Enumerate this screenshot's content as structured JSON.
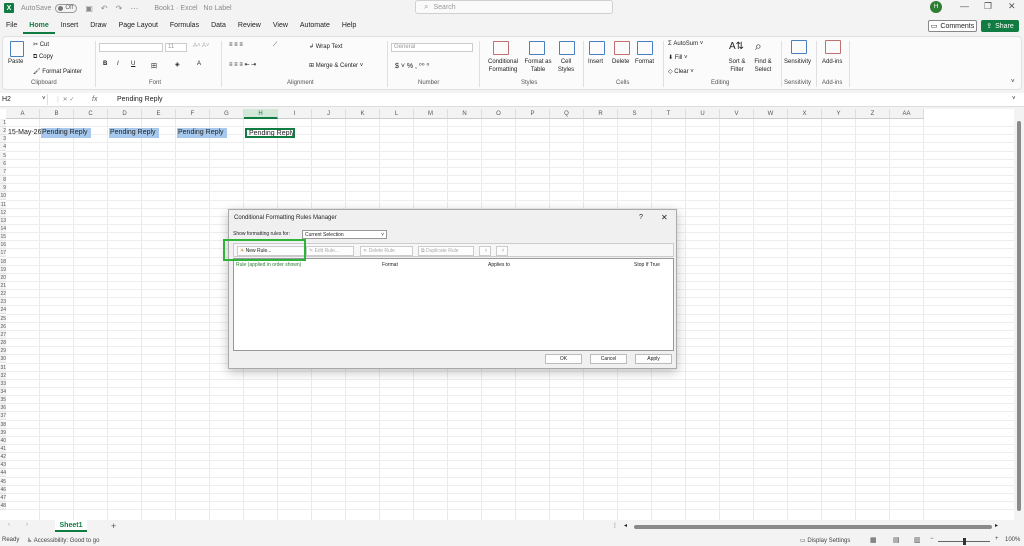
{
  "titlebar": {
    "autosave_label": "AutoSave",
    "autosave_state": "Off",
    "doc_title": "Book1  ·  Excel",
    "label_text": "No Label",
    "search_placeholder": "Search",
    "avatar_initial": "H"
  },
  "menu": {
    "items": [
      "File",
      "Home",
      "Insert",
      "Draw",
      "Page Layout",
      "Formulas",
      "Data",
      "Review",
      "View",
      "Automate",
      "Help"
    ],
    "active": "Home",
    "comments": "Comments",
    "share": "Share"
  },
  "ribbon": {
    "clipboard": {
      "paste": "Paste",
      "cut": "Cut",
      "copy": "Copy",
      "format_painter": "Format Painter",
      "label": "Clipboard"
    },
    "font": {
      "label": "Font",
      "size": "11"
    },
    "alignment": {
      "wrap": "Wrap Text",
      "merge": "Merge & Center",
      "label": "Alignment"
    },
    "number": {
      "format": "General",
      "label": "Number"
    },
    "styles": {
      "cond": "Conditional Formatting",
      "table": "Format as Table",
      "cell": "Cell Styles",
      "label": "Styles"
    },
    "cells": {
      "insert": "Insert",
      "delete": "Delete",
      "format": "Format",
      "label": "Cells"
    },
    "editing": {
      "autosum": "AutoSum",
      "fill": "Fill",
      "clear": "Clear",
      "sort": "Sort & Filter",
      "find": "Find & Select",
      "label": "Editing"
    },
    "sensitivity": {
      "btn": "Sensitivity",
      "label": "Sensitivity"
    },
    "addins": {
      "btn": "Add-ins",
      "label": "Add-ins"
    }
  },
  "formula_bar": {
    "name_box": "H2",
    "fx": "fx",
    "value": "Pending Reply"
  },
  "grid": {
    "columns": [
      "A",
      "B",
      "C",
      "D",
      "E",
      "F",
      "G",
      "H",
      "I",
      "J",
      "K",
      "L",
      "M",
      "N",
      "O",
      "P",
      "Q",
      "R",
      "S",
      "T",
      "U",
      "V",
      "W",
      "X",
      "Y",
      "Z",
      "AA"
    ],
    "selected_column": "H",
    "row_count": 48,
    "cells": {
      "A2": "15-May-26",
      "B2": "Pending Reply",
      "D2": "Pending Reply",
      "F2": "Pending Reply",
      "H2": "Pending Reply"
    }
  },
  "sheet": {
    "tab": "Sheet1",
    "add": "+"
  },
  "status": {
    "ready": "Ready",
    "accessibility": "Accessibility: Good to go",
    "display": "Display Settings",
    "zoom": "100%"
  },
  "dialog": {
    "title": "Conditional Formatting Rules Manager",
    "help": "?",
    "close": "✕",
    "show_label": "Show formatting rules for:",
    "show_value": "Current Selection",
    "toolbar": {
      "new": "New Rule...",
      "edit": "Edit Rule...",
      "delete": "Delete Rule",
      "duplicate": "Duplicate Rule"
    },
    "columns": {
      "rule": "Rule (applied in order shown)",
      "format": "Format",
      "applies": "Applies to",
      "stop": "Stop If True"
    },
    "ok": "OK",
    "cancel": "Cancel",
    "apply": "Apply"
  }
}
